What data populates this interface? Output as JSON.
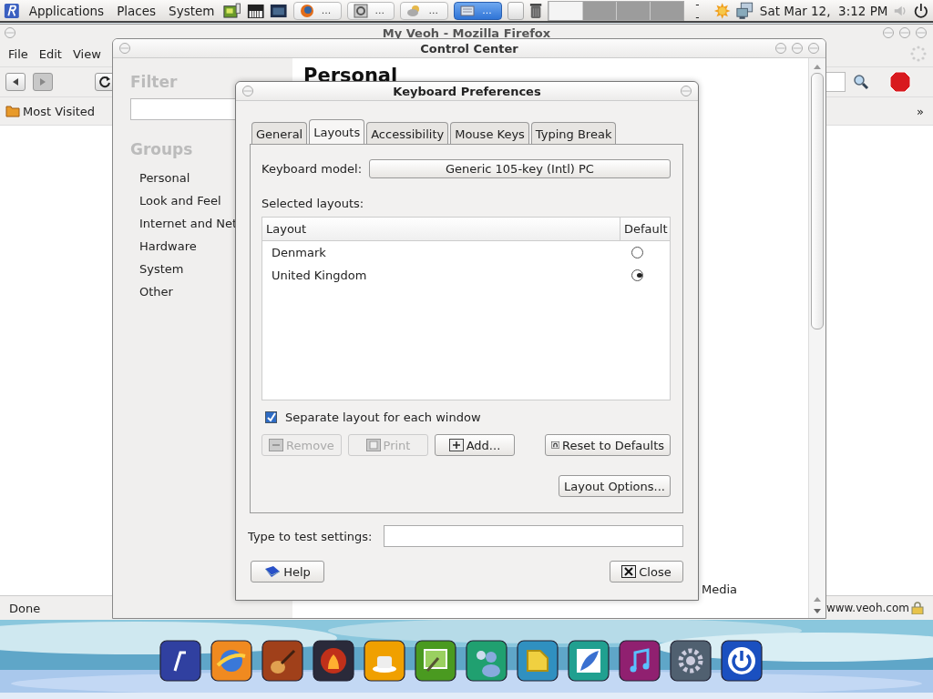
{
  "top_panel": {
    "menus": [
      "Applications",
      "Places",
      "System"
    ],
    "tasks": [
      {
        "kind": "browser",
        "label": "...",
        "selected": false
      },
      {
        "kind": "settings",
        "label": "...",
        "selected": false
      },
      {
        "kind": "weather",
        "label": "...",
        "selected": false
      },
      {
        "kind": "keyboard",
        "label": "...",
        "selected": true
      }
    ],
    "workspaces": [
      {
        "selected": true
      },
      {
        "selected": false
      },
      {
        "selected": false
      },
      {
        "selected": false
      }
    ],
    "workspace_label": "--",
    "clock": "Sat Mar 12,  3:12 PM"
  },
  "firefox": {
    "title": "My Veoh - Mozilla Firefox",
    "menu": [
      "File",
      "Edit",
      "View"
    ],
    "bookmarks": [
      "Most Visited"
    ],
    "overflow": "»",
    "status": "Done",
    "url": "www.veoh.com"
  },
  "control_center": {
    "title": "Control Center",
    "filter_label": "Filter",
    "groups_label": "Groups",
    "groups": [
      "Personal",
      "Look and Feel",
      "Internet and Net",
      "Hardware",
      "System",
      "Other"
    ],
    "heading": "Personal",
    "item": "Media"
  },
  "keyboard_preferences": {
    "title": "Keyboard Preferences",
    "tabs": [
      {
        "label": "General",
        "selected": false
      },
      {
        "label": "Layouts",
        "selected": true
      },
      {
        "label": "Accessibility",
        "selected": false
      },
      {
        "label": "Mouse Keys",
        "selected": false
      },
      {
        "label": "Typing Break",
        "selected": false
      }
    ],
    "model_label": "Keyboard model:",
    "model": "Generic 105-key (Intl) PC",
    "selected_layouts_label": "Selected layouts:",
    "columns": [
      "Layout",
      "Default"
    ],
    "layouts": [
      {
        "name": "Denmark",
        "default": false
      },
      {
        "name": "United Kingdom",
        "default": true
      }
    ],
    "separate": {
      "label": "Separate layout for each window",
      "checked": true
    },
    "buttons": [
      {
        "kind": "remove",
        "label": "Remove",
        "disabled": true
      },
      {
        "kind": "print",
        "label": "Print",
        "disabled": true
      },
      {
        "kind": "add",
        "label": "Add...",
        "disabled": false
      },
      {
        "kind": "reset",
        "label": "Reset to Defaults",
        "disabled": false
      }
    ],
    "options_button": "Layout Options...",
    "test_label": "Type to test settings:",
    "help": "Help",
    "close": "Close"
  }
}
